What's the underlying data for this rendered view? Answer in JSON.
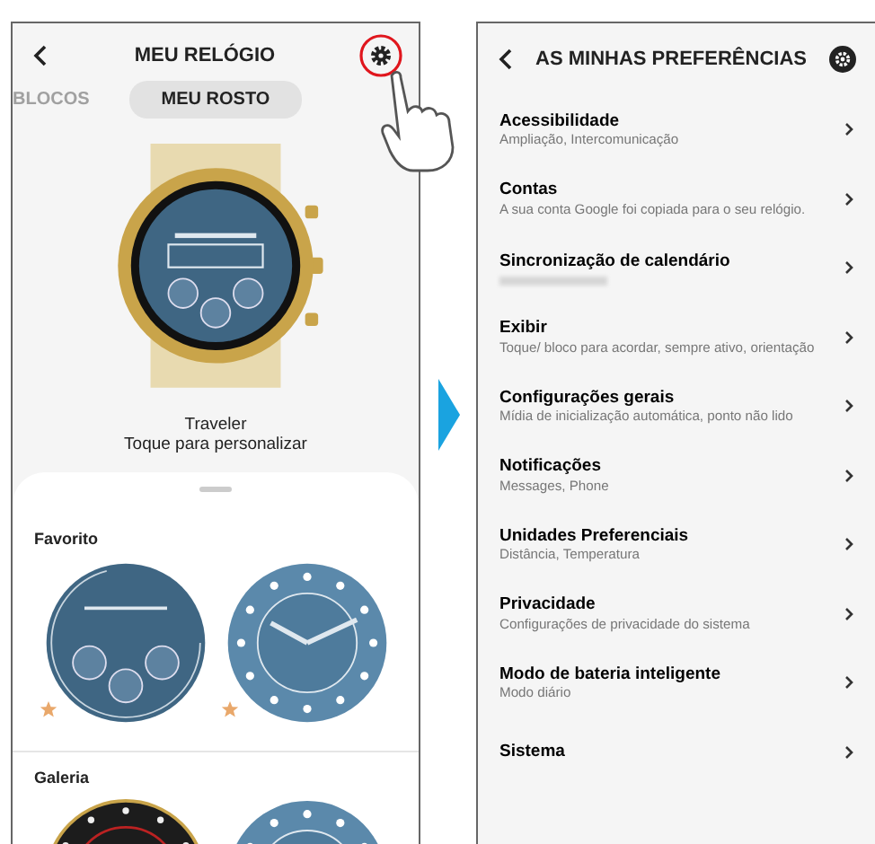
{
  "left_screen": {
    "title": "MEU RELÓGIO",
    "settings_highlighted": true,
    "tabs": [
      {
        "label": "BLOCOS",
        "selected": false
      },
      {
        "label": "MEU ROSTO",
        "selected": true
      }
    ],
    "watch_name": "Traveler",
    "watch_hint": "Toque para personalizar",
    "sections": [
      {
        "title": "Favorito",
        "faces": [
          {
            "kind": "digital",
            "favorite": true
          },
          {
            "kind": "analog",
            "favorite": true
          }
        ]
      },
      {
        "title": "Galeria",
        "faces": [
          {
            "kind": "dark"
          },
          {
            "kind": "analog"
          }
        ]
      }
    ]
  },
  "right_screen": {
    "title": "AS MINHAS PREFERÊNCIAS",
    "items": [
      {
        "title": "Acessibilidade",
        "subtitle": "Ampliação, Intercomunicação",
        "redacted": false
      },
      {
        "title": "Contas",
        "subtitle": "A sua conta Google foi copiada para o seu relógio.",
        "redacted": false
      },
      {
        "title": "Sincronização de calendário",
        "redacted": true
      },
      {
        "title": "Exibir",
        "subtitle": "Toque/ bloco para acordar, sempre ativo, orientação",
        "redacted": false
      },
      {
        "title": "Configurações gerais",
        "subtitle": "Mídia de inicialização automática, ponto não lido",
        "redacted": false
      },
      {
        "title": "Notificações",
        "subtitle": "Messages, Phone",
        "redacted": false
      },
      {
        "title": "Unidades Preferenciais",
        "subtitle": "Distância, Temperatura",
        "redacted": false
      },
      {
        "title": "Privacidade",
        "subtitle": "Configurações de privacidade do sistema",
        "redacted": false
      },
      {
        "title": "Modo de bateria inteligente",
        "subtitle": "Modo diário",
        "redacted": false
      },
      {
        "title": "Sistema",
        "redacted": false
      }
    ]
  }
}
